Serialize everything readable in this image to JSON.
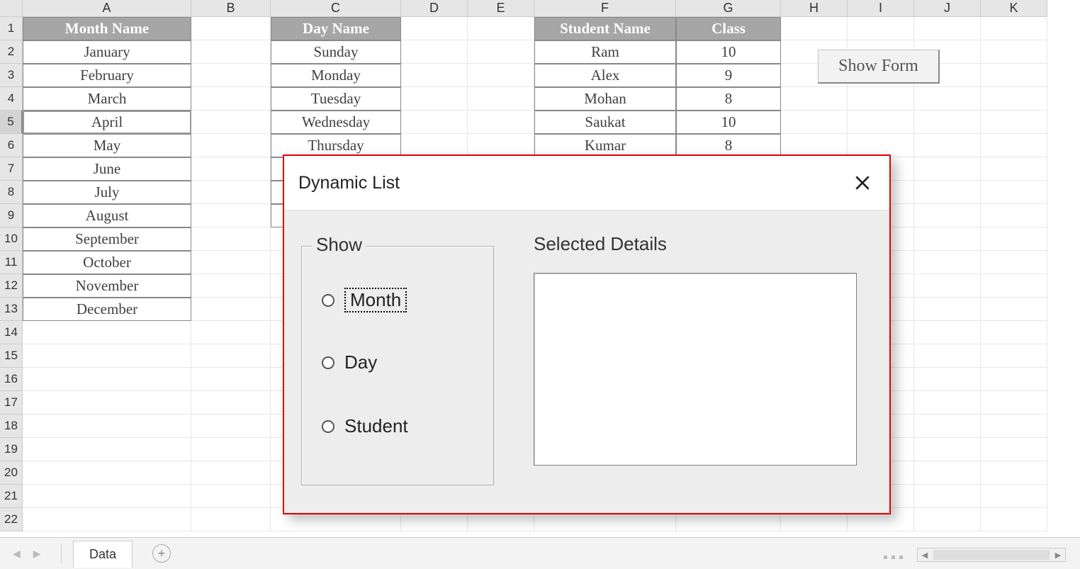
{
  "columns": [
    "A",
    "B",
    "C",
    "D",
    "E",
    "F",
    "G",
    "H",
    "I",
    "J",
    "K"
  ],
  "row_count": 22,
  "selected_row": 5,
  "tableA": {
    "header": "Month Name",
    "rows": [
      "January",
      "February",
      "March",
      "April",
      "May",
      "June",
      "July",
      "August",
      "September",
      "October",
      "November",
      "December"
    ]
  },
  "tableC": {
    "header": "Day Name",
    "rows": [
      "Sunday",
      "Monday",
      "Tuesday",
      "Wednesday",
      "Thursday",
      "",
      "",
      ""
    ]
  },
  "tableFG": {
    "headers": [
      "Student Name",
      "Class"
    ],
    "rows": [
      [
        "Ram",
        "10"
      ],
      [
        "Alex",
        "9"
      ],
      [
        "Mohan",
        "8"
      ],
      [
        "Saukat",
        "10"
      ],
      [
        "Kumar",
        "8"
      ]
    ]
  },
  "button_show_form": "Show Form",
  "dialog": {
    "title": "Dynamic List",
    "group_label": "Show",
    "radios": [
      "Month",
      "Day",
      "Student"
    ],
    "focused_radio": 0,
    "details_label": "Selected Details"
  },
  "sheet_tab": "Data"
}
